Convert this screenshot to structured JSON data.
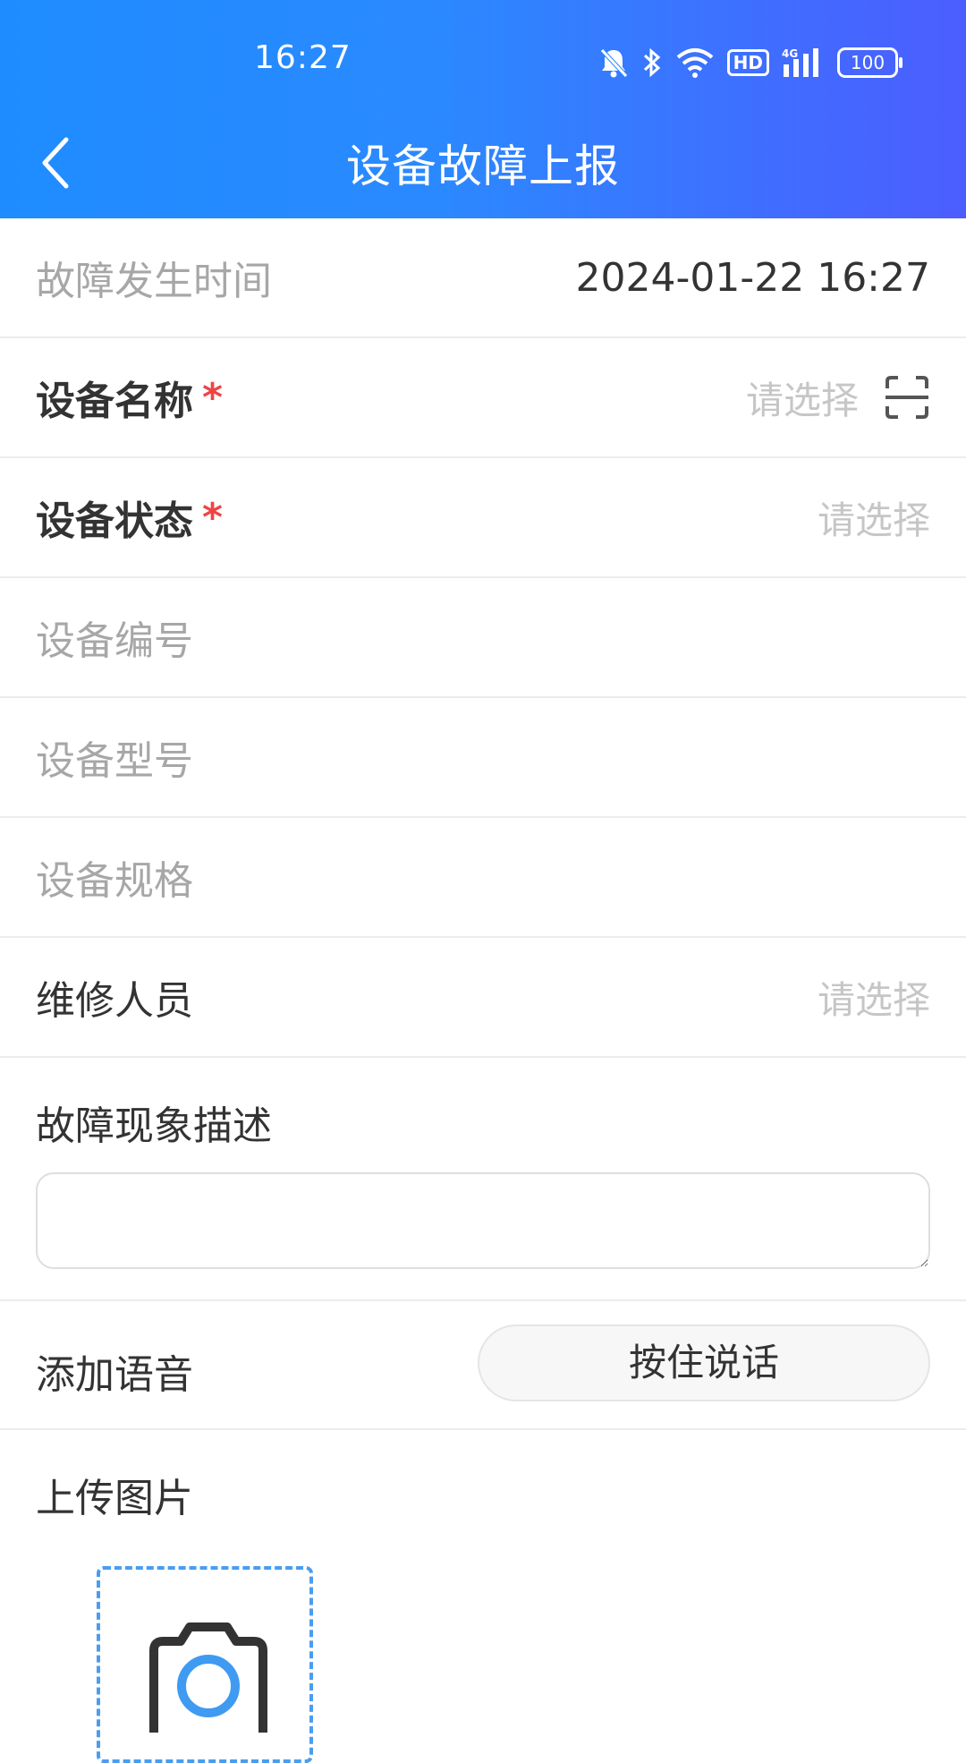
{
  "status_bar": {
    "time": "16:27",
    "hd": "HD",
    "battery": "100",
    "icons": [
      "mute-bell-icon",
      "bluetooth-icon",
      "wifi-icon",
      "hd-icon",
      "4g-signal-icon",
      "battery-icon"
    ]
  },
  "header": {
    "title": "设备故障上报",
    "back_icon": "chevron-left-icon"
  },
  "form": {
    "fault_time": {
      "label": "故障发生时间",
      "value": "2024-01-22 16:27"
    },
    "device_name": {
      "label": "设备名称",
      "required_mark": "*",
      "placeholder": "请选择",
      "icon": "scan-icon"
    },
    "device_status": {
      "label": "设备状态",
      "required_mark": "*",
      "placeholder": "请选择"
    },
    "device_number": {
      "label": "设备编号"
    },
    "device_model": {
      "label": "设备型号"
    },
    "device_spec": {
      "label": "设备规格"
    },
    "repair_person": {
      "label": "维修人员",
      "placeholder": "请选择"
    },
    "description": {
      "label": "故障现象描述",
      "value": ""
    },
    "voice": {
      "label": "添加语音",
      "button_label": "按住说话"
    },
    "upload": {
      "label": "上传图片",
      "icon": "camera-icon"
    }
  },
  "colors": {
    "header_gradient_start": "#1e8cff",
    "header_gradient_end": "#4c5dff",
    "required": "#f04444",
    "upload_border": "#4a9df0"
  }
}
